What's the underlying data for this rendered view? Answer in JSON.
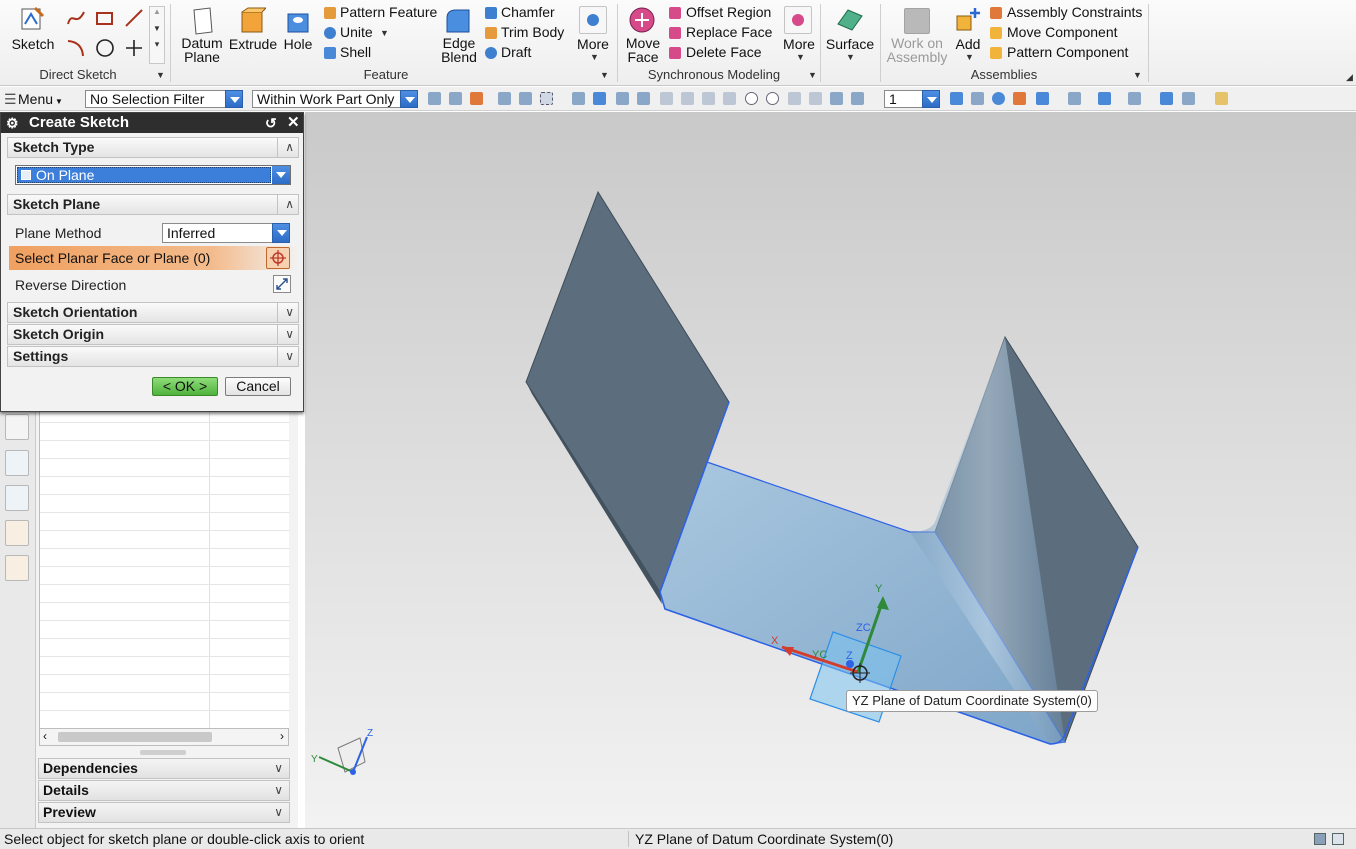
{
  "ribbon": {
    "direct_sketch": {
      "sketch_label": "Sketch",
      "group_title": "Direct Sketch"
    },
    "feature": {
      "datum_plane_line1": "Datum",
      "datum_plane_line2": "Plane",
      "extrude_label": "Extrude",
      "hole_label": "Hole",
      "pattern_feature_label": "Pattern Feature",
      "unite_label": "Unite",
      "shell_label": "Shell",
      "edge_blend_line1": "Edge",
      "edge_blend_line2": "Blend",
      "chamfer_label": "Chamfer",
      "trim_body_label": "Trim Body",
      "draft_label": "Draft",
      "more_label": "More",
      "group_title": "Feature"
    },
    "synchronous": {
      "move_face_line1": "Move",
      "move_face_line2": "Face",
      "offset_region_label": "Offset Region",
      "replace_face_label": "Replace Face",
      "delete_face_label": "Delete Face",
      "more_label": "More",
      "group_title": "Synchronous Modeling"
    },
    "surface_label": "Surface",
    "assemblies": {
      "work_on_line1": "Work on",
      "work_on_line2": "Assembly",
      "add_label": "Add",
      "assembly_constraints_label": "Assembly Constraints",
      "move_component_label": "Move Component",
      "pattern_component_label": "Pattern Component",
      "group_title": "Assemblies"
    }
  },
  "selection_bar": {
    "menu_label": "Menu",
    "filter_value": "No Selection Filter",
    "scope_value": "Within Work Part Only",
    "layer_value": "1"
  },
  "dialog": {
    "title": "Create Sketch",
    "sketch_type_header": "Sketch Type",
    "sketch_type_value": "On Plane",
    "sketch_plane_header": "Sketch Plane",
    "plane_method_label": "Plane Method",
    "plane_method_value": "Inferred",
    "select_planar_label": "Select Planar Face or Plane (0)",
    "reverse_direction_label": "Reverse Direction",
    "sketch_orientation_header": "Sketch Orientation",
    "sketch_origin_header": "Sketch Origin",
    "settings_header": "Settings",
    "ok_label": "< OK >",
    "cancel_label": "Cancel"
  },
  "navigator": {
    "dependencies_label": "Dependencies",
    "details_label": "Details",
    "preview_label": "Preview"
  },
  "viewport": {
    "tooltip": "YZ Plane of Datum Coordinate System(0)",
    "csys_labels": {
      "x": "X",
      "y": "Y",
      "z": "Z",
      "xc": "YC",
      "zc": "ZC",
      "triad_z": "Z",
      "triad_y": "Y"
    }
  },
  "status_bar": {
    "prompt": "Select object for sketch plane or double-click axis to orient",
    "selection": "YZ Plane of Datum Coordinate System(0)"
  },
  "colors": {
    "part_dark_face": "#5c6e7d",
    "part_light_face": "#8fb3d1",
    "highlight_edge": "#2d62e6",
    "selected_row": "#3c7fdb",
    "select_highlight": "#f0a060"
  }
}
